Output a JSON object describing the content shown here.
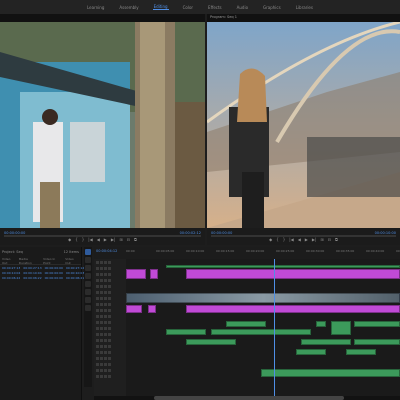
{
  "workspace_tabs": [
    "Learning",
    "Assembly",
    "Editing",
    "Color",
    "Effects",
    "Audio",
    "Graphics",
    "Libraries"
  ],
  "active_tab": "Editing",
  "source_monitor": {
    "title": "",
    "timecode_in": "00:00:00:00",
    "timecode_out": "00:00:02:12",
    "controls": [
      "◆",
      "{",
      "}",
      "|◀",
      "◀",
      "▶",
      "▶|",
      "⊞",
      "⊟",
      "⧉"
    ]
  },
  "program_monitor": {
    "title": "Program: Seq 1",
    "timecode_in": "00:00:00:00",
    "timecode_out": "00:00:10:00",
    "controls": [
      "◆",
      "{",
      "}",
      "|◀",
      "◀",
      "▶",
      "▶|",
      "⊞",
      "⊟",
      "⧉"
    ]
  },
  "project_panel": {
    "title": "Project: Seq",
    "item_count": "12 Items",
    "columns": [
      "Video Out",
      "Media Duration",
      "Video In Point",
      "Video Out"
    ],
    "rows": [
      {
        "a": "00:00:27:13",
        "b": "00:00:27:13",
        "c": "00:00:00:00",
        "d": "00:00:27:12"
      },
      {
        "a": "00:00:10:04",
        "b": "00:00:10:04",
        "c": "00:00:00:00",
        "d": "00:00:10:03"
      },
      {
        "a": "00:00:06:22",
        "b": "00:00:06:22",
        "c": "00:00:00:00",
        "d": "00:00:06:21"
      }
    ]
  },
  "timeline": {
    "timecode": "00:00:04:12",
    "ruler_ticks": [
      "00:00",
      "00:00:05:00",
      "00:00:10:00",
      "00:00:15:00",
      "00:00:20:00",
      "00:00:25:00",
      "00:00:30:00",
      "00:00:35:00",
      "00:00:40:00",
      "00:00:45:00"
    ]
  },
  "colors": {
    "accent": "#4f8fe6",
    "video_clip": "#c04ad6",
    "audio_clip": "#3c9a5b"
  }
}
